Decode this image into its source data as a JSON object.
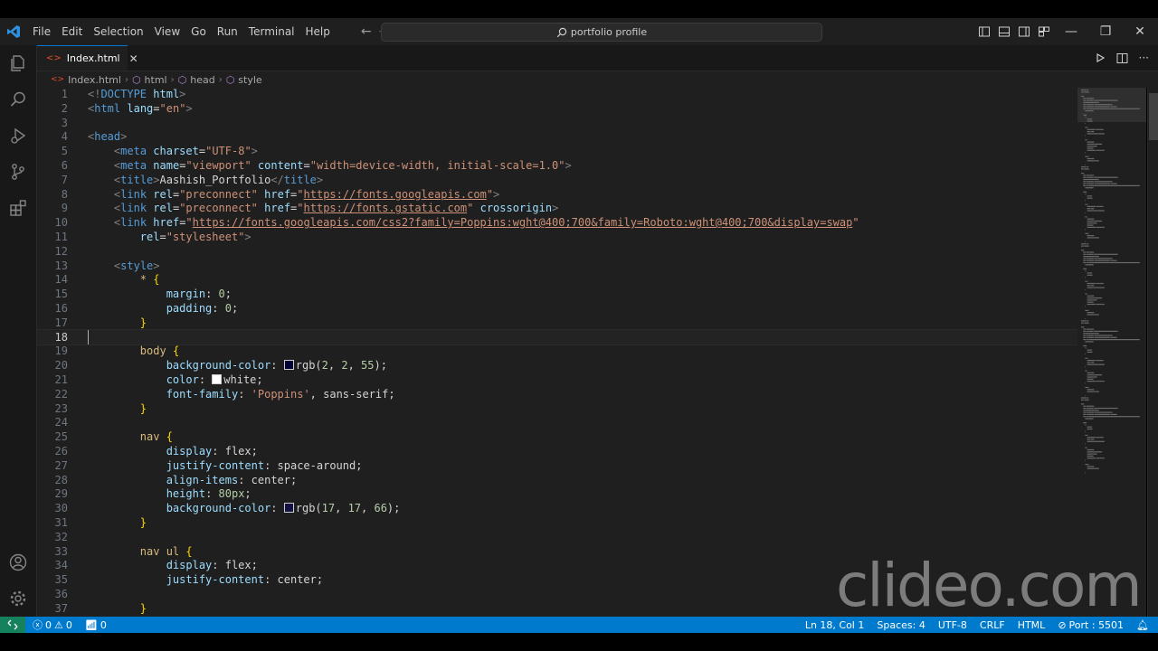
{
  "menu": [
    "File",
    "Edit",
    "Selection",
    "View",
    "Go",
    "Run",
    "Terminal",
    "Help"
  ],
  "search": {
    "label": "portfolio profile"
  },
  "tab": {
    "label": "Index.html"
  },
  "breadcrumbs": [
    "Index.html",
    "html",
    "head",
    "style"
  ],
  "editor": {
    "active_line": 18,
    "lines": [
      [
        [
          "tok-pun",
          "<!"
        ],
        [
          "tok-doc",
          "DOCTYPE"
        ],
        [
          "tok-txt",
          " "
        ],
        [
          "tok-attr",
          "html"
        ],
        [
          "tok-pun",
          ">"
        ]
      ],
      [
        [
          "tok-pun",
          "<"
        ],
        [
          "tok-tag",
          "html"
        ],
        [
          "tok-txt",
          " "
        ],
        [
          "tok-attr",
          "lang"
        ],
        [
          "tok-txt",
          "="
        ],
        [
          "tok-str",
          "\"en\""
        ],
        [
          "tok-pun",
          ">"
        ]
      ],
      [],
      [
        [
          "tok-pun",
          "<"
        ],
        [
          "tok-tag",
          "head"
        ],
        [
          "tok-pun",
          ">"
        ]
      ],
      [
        [
          "tok-txt",
          "    "
        ],
        [
          "tok-pun",
          "<"
        ],
        [
          "tok-tag",
          "meta"
        ],
        [
          "tok-txt",
          " "
        ],
        [
          "tok-attr",
          "charset"
        ],
        [
          "tok-txt",
          "="
        ],
        [
          "tok-str",
          "\"UTF-8\""
        ],
        [
          "tok-pun",
          ">"
        ]
      ],
      [
        [
          "tok-txt",
          "    "
        ],
        [
          "tok-pun",
          "<"
        ],
        [
          "tok-tag",
          "meta"
        ],
        [
          "tok-txt",
          " "
        ],
        [
          "tok-attr",
          "name"
        ],
        [
          "tok-txt",
          "="
        ],
        [
          "tok-str",
          "\"viewport\""
        ],
        [
          "tok-txt",
          " "
        ],
        [
          "tok-attr",
          "content"
        ],
        [
          "tok-txt",
          "="
        ],
        [
          "tok-str",
          "\"width=device-width, initial-scale=1.0\""
        ],
        [
          "tok-pun",
          ">"
        ]
      ],
      [
        [
          "tok-txt",
          "    "
        ],
        [
          "tok-pun",
          "<"
        ],
        [
          "tok-tag",
          "title"
        ],
        [
          "tok-pun",
          ">"
        ],
        [
          "tok-txt",
          "Aashish_Portfolio"
        ],
        [
          "tok-pun",
          "</"
        ],
        [
          "tok-tag",
          "title"
        ],
        [
          "tok-pun",
          ">"
        ]
      ],
      [
        [
          "tok-txt",
          "    "
        ],
        [
          "tok-pun",
          "<"
        ],
        [
          "tok-tag",
          "link"
        ],
        [
          "tok-txt",
          " "
        ],
        [
          "tok-attr",
          "rel"
        ],
        [
          "tok-txt",
          "="
        ],
        [
          "tok-str",
          "\"preconnect\""
        ],
        [
          "tok-txt",
          " "
        ],
        [
          "tok-attr",
          "href"
        ],
        [
          "tok-txt",
          "="
        ],
        [
          "tok-str",
          "\""
        ],
        [
          "tok-url",
          "https://fonts.googleapis.com"
        ],
        [
          "tok-str",
          "\""
        ],
        [
          "tok-pun",
          ">"
        ]
      ],
      [
        [
          "tok-txt",
          "    "
        ],
        [
          "tok-pun",
          "<"
        ],
        [
          "tok-tag",
          "link"
        ],
        [
          "tok-txt",
          " "
        ],
        [
          "tok-attr",
          "rel"
        ],
        [
          "tok-txt",
          "="
        ],
        [
          "tok-str",
          "\"preconnect\""
        ],
        [
          "tok-txt",
          " "
        ],
        [
          "tok-attr",
          "href"
        ],
        [
          "tok-txt",
          "="
        ],
        [
          "tok-str",
          "\""
        ],
        [
          "tok-url",
          "https://fonts.gstatic.com"
        ],
        [
          "tok-str",
          "\""
        ],
        [
          "tok-txt",
          " "
        ],
        [
          "tok-attr",
          "crossorigin"
        ],
        [
          "tok-pun",
          ">"
        ]
      ],
      [
        [
          "tok-txt",
          "    "
        ],
        [
          "tok-pun",
          "<"
        ],
        [
          "tok-tag",
          "link"
        ],
        [
          "tok-txt",
          " "
        ],
        [
          "tok-attr",
          "href"
        ],
        [
          "tok-txt",
          "="
        ],
        [
          "tok-str",
          "\""
        ],
        [
          "tok-url",
          "https://fonts.googleapis.com/css2?family=Poppins:wght@400;700&family=Roboto:wght@400;700&display=swap"
        ],
        [
          "tok-str",
          "\""
        ]
      ],
      [
        [
          "tok-txt",
          "        "
        ],
        [
          "tok-attr",
          "rel"
        ],
        [
          "tok-txt",
          "="
        ],
        [
          "tok-str",
          "\"stylesheet\""
        ],
        [
          "tok-pun",
          ">"
        ]
      ],
      [],
      [
        [
          "tok-txt",
          "    "
        ],
        [
          "tok-pun",
          "<"
        ],
        [
          "tok-tag",
          "style"
        ],
        [
          "tok-pun",
          ">"
        ]
      ],
      [
        [
          "tok-txt",
          "        "
        ],
        [
          "tok-sel",
          "*"
        ],
        [
          "tok-txt",
          " "
        ],
        [
          "tok-br",
          "{"
        ]
      ],
      [
        [
          "tok-txt",
          "            "
        ],
        [
          "tok-prop",
          "margin"
        ],
        [
          "tok-txt",
          ": "
        ],
        [
          "tok-num",
          "0"
        ],
        [
          "tok-txt",
          ";"
        ]
      ],
      [
        [
          "tok-txt",
          "            "
        ],
        [
          "tok-prop",
          "padding"
        ],
        [
          "tok-txt",
          ": "
        ],
        [
          "tok-num",
          "0"
        ],
        [
          "tok-txt",
          ";"
        ]
      ],
      [
        [
          "tok-txt",
          "        "
        ],
        [
          "tok-br",
          "}"
        ]
      ],
      [],
      [
        [
          "tok-txt",
          "        "
        ],
        [
          "tok-sel",
          "body"
        ],
        [
          "tok-txt",
          " "
        ],
        [
          "tok-br",
          "{"
        ]
      ],
      [
        [
          "tok-txt",
          "            "
        ],
        [
          "tok-prop",
          "background-color"
        ],
        [
          "tok-txt",
          ": "
        ],
        [
          "swatch",
          "#020237"
        ],
        [
          "tok-val",
          "rgb("
        ],
        [
          "tok-num",
          "2"
        ],
        [
          "tok-val",
          ", "
        ],
        [
          "tok-num",
          "2"
        ],
        [
          "tok-val",
          ", "
        ],
        [
          "tok-num",
          "55"
        ],
        [
          "tok-val",
          ");"
        ]
      ],
      [
        [
          "tok-txt",
          "            "
        ],
        [
          "tok-prop",
          "color"
        ],
        [
          "tok-txt",
          ": "
        ],
        [
          "swatch",
          "#ffffff"
        ],
        [
          "tok-val",
          "white;"
        ]
      ],
      [
        [
          "tok-txt",
          "            "
        ],
        [
          "tok-prop",
          "font-family"
        ],
        [
          "tok-txt",
          ": "
        ],
        [
          "tok-str",
          "'Poppins'"
        ],
        [
          "tok-val",
          ", sans-serif;"
        ]
      ],
      [
        [
          "tok-txt",
          "        "
        ],
        [
          "tok-br",
          "}"
        ]
      ],
      [],
      [
        [
          "tok-txt",
          "        "
        ],
        [
          "tok-sel",
          "nav"
        ],
        [
          "tok-txt",
          " "
        ],
        [
          "tok-br",
          "{"
        ]
      ],
      [
        [
          "tok-txt",
          "            "
        ],
        [
          "tok-prop",
          "display"
        ],
        [
          "tok-txt",
          ": "
        ],
        [
          "tok-val",
          "flex;"
        ]
      ],
      [
        [
          "tok-txt",
          "            "
        ],
        [
          "tok-prop",
          "justify-content"
        ],
        [
          "tok-txt",
          ": "
        ],
        [
          "tok-val",
          "space-around;"
        ]
      ],
      [
        [
          "tok-txt",
          "            "
        ],
        [
          "tok-prop",
          "align-items"
        ],
        [
          "tok-txt",
          ": "
        ],
        [
          "tok-val",
          "center;"
        ]
      ],
      [
        [
          "tok-txt",
          "            "
        ],
        [
          "tok-prop",
          "height"
        ],
        [
          "tok-txt",
          ": "
        ],
        [
          "tok-num",
          "80px"
        ],
        [
          "tok-val",
          ";"
        ]
      ],
      [
        [
          "tok-txt",
          "            "
        ],
        [
          "tok-prop",
          "background-color"
        ],
        [
          "tok-txt",
          ": "
        ],
        [
          "swatch",
          "#111142"
        ],
        [
          "tok-val",
          "rgb("
        ],
        [
          "tok-num",
          "17"
        ],
        [
          "tok-val",
          ", "
        ],
        [
          "tok-num",
          "17"
        ],
        [
          "tok-val",
          ", "
        ],
        [
          "tok-num",
          "66"
        ],
        [
          "tok-val",
          ");"
        ]
      ],
      [
        [
          "tok-txt",
          "        "
        ],
        [
          "tok-br",
          "}"
        ]
      ],
      [],
      [
        [
          "tok-txt",
          "        "
        ],
        [
          "tok-sel",
          "nav ul"
        ],
        [
          "tok-txt",
          " "
        ],
        [
          "tok-br",
          "{"
        ]
      ],
      [
        [
          "tok-txt",
          "            "
        ],
        [
          "tok-prop",
          "display"
        ],
        [
          "tok-txt",
          ": "
        ],
        [
          "tok-val",
          "flex;"
        ]
      ],
      [
        [
          "tok-txt",
          "            "
        ],
        [
          "tok-prop",
          "justify-content"
        ],
        [
          "tok-txt",
          ": "
        ],
        [
          "tok-val",
          "center;"
        ]
      ],
      [],
      [
        [
          "tok-txt",
          "        "
        ],
        [
          "tok-br",
          "}"
        ]
      ]
    ]
  },
  "watermark": "clideo.com",
  "status": {
    "errors": "0",
    "warnings": "0",
    "ports": "0",
    "cursor": "Ln 18, Col 1",
    "spaces": "Spaces: 4",
    "encoding": "UTF-8",
    "eol": "CRLF",
    "language": "HTML",
    "port": "Port : 5501"
  },
  "colors": {
    "accent": "#0078d4",
    "status_bg": "#007acc",
    "editor_bg": "#1f1f1f"
  }
}
